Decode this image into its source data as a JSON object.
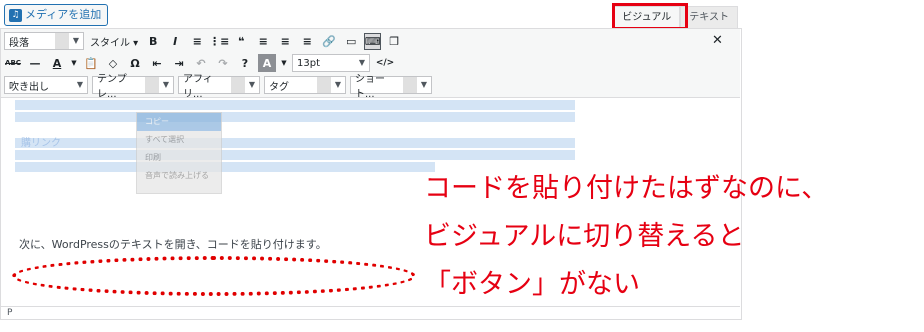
{
  "add_media": {
    "label": "メディアを追加",
    "icon": "media-icon"
  },
  "tabs": [
    {
      "label": "ビジュアル",
      "active": true
    },
    {
      "label": "テキスト",
      "active": false
    }
  ],
  "toolbar": {
    "row1": {
      "format_select": "段落",
      "style_select": "スタイル ▾",
      "buttons": [
        "B",
        "I",
        "≡",
        "⋮≡",
        "❝",
        "≡",
        "≡",
        "≡",
        "🔗",
        "▭",
        "⌨",
        "❐"
      ]
    },
    "row2": {
      "buttons": [
        "ABC",
        "—",
        "A",
        "📋",
        "◇",
        "Ω",
        "⇤",
        "⇥",
        "↶",
        "↷",
        "?",
        "A"
      ],
      "font_size": "13pt",
      "code_icon": "</>"
    },
    "row3": {
      "selects": [
        "吹き出し",
        "テンプレ...",
        "アフィリ...",
        "タグ",
        "ショート..."
      ]
    }
  },
  "context_menu": [
    "コピー",
    "すべて選択",
    "印刷",
    "音声で読み上げる"
  ],
  "content": {
    "faded_label": "購リンク",
    "body_line": "次に、WordPressのテキストを開き、コードを貼り付けます。"
  },
  "status_bar": "P",
  "annotations": [
    "コードを貼り付けたはずなのに、",
    "ビジュアルに切り替えると",
    "「ボタン」がない"
  ],
  "colors": {
    "highlight": "#e60012",
    "accent": "#2271b1"
  }
}
